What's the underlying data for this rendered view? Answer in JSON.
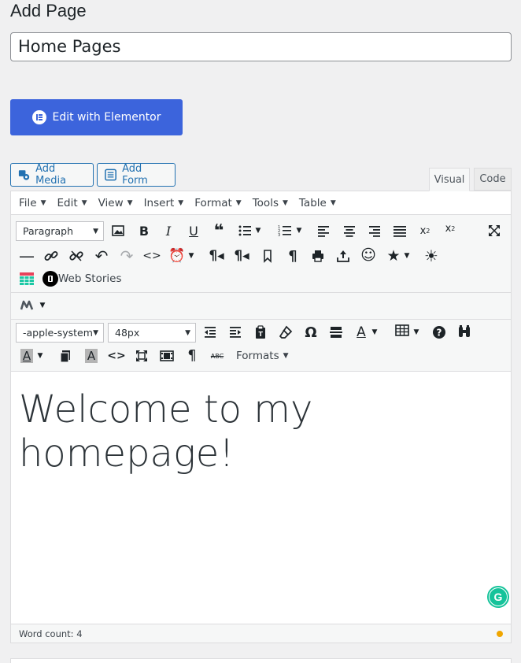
{
  "page": {
    "title": "Add Page"
  },
  "post_title": {
    "value": "Home Pages"
  },
  "elementor": {
    "label": "Edit with Elementor"
  },
  "media_buttons": {
    "add_media": "Add Media",
    "add_form": "Add Form"
  },
  "tabs": {
    "visual": "Visual",
    "code": "Code"
  },
  "menubar": [
    {
      "label": "File"
    },
    {
      "label": "Edit"
    },
    {
      "label": "View"
    },
    {
      "label": "Insert"
    },
    {
      "label": "Format"
    },
    {
      "label": "Tools"
    },
    {
      "label": "Table"
    }
  ],
  "toolbar": {
    "block_format": "Paragraph",
    "font_family": "-apple-system",
    "font_size": "48px",
    "web_stories": "Web Stories",
    "formats": "Formats"
  },
  "content": {
    "text": "Welcome to my homepage!"
  },
  "status": {
    "word_count": "Word count: 4"
  },
  "colors": {
    "accent": "#3c64dc",
    "link": "#2271b1",
    "status_dot": "#f0a600",
    "grammarly": "#15c39a"
  }
}
